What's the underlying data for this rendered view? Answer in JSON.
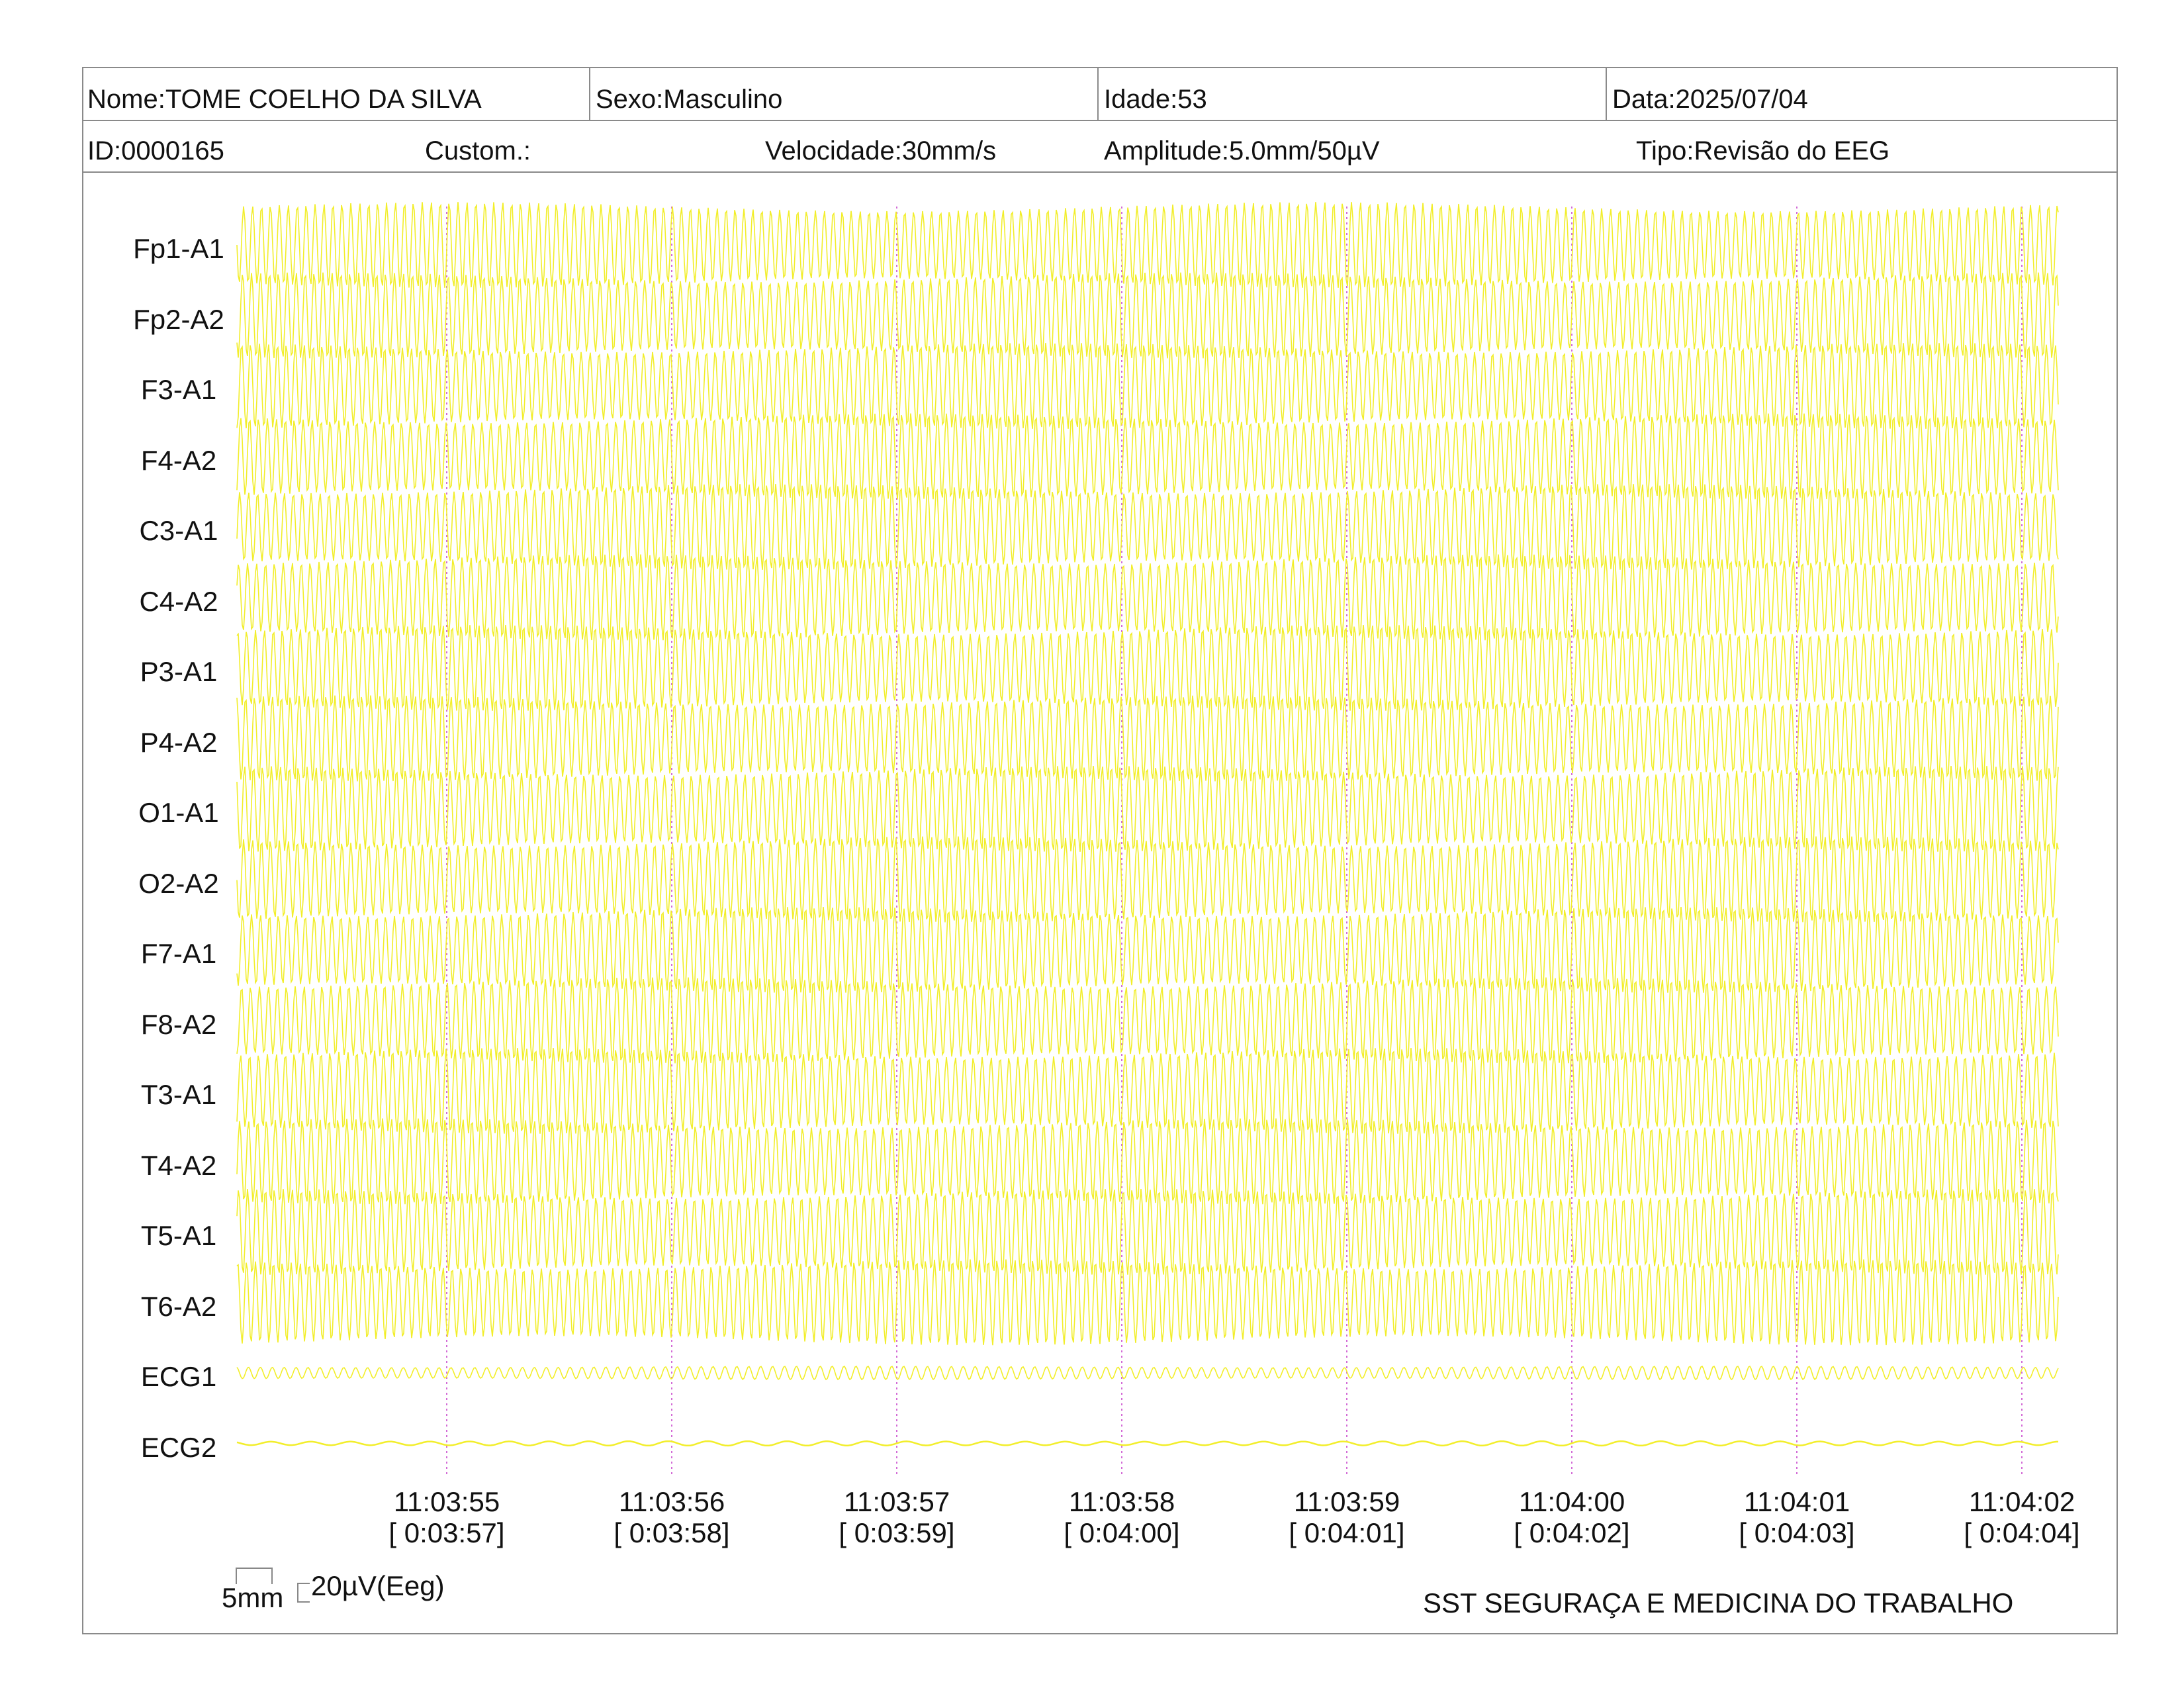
{
  "header": {
    "nome": "Nome:TOME COELHO DA SILVA",
    "sexo": "Sexo:Masculino",
    "idade": "Idade:53",
    "data": "Data:2025/07/04",
    "id": "ID:0000165",
    "custom": "Custom.:",
    "velocidade": "Velocidade:30mm/s",
    "amplitude": "Amplitude:5.0mm/50µV",
    "tipo": "Tipo:Revisão do EEG"
  },
  "channels": [
    "Fp1-A1",
    "Fp2-A2",
    "F3-A1",
    "F4-A2",
    "C3-A1",
    "C4-A2",
    "P3-A1",
    "P4-A2",
    "O1-A1",
    "O2-A2",
    "F7-A1",
    "F8-A2",
    "T3-A1",
    "T4-A2",
    "T5-A1",
    "T6-A2",
    "ECG1",
    "ECG2"
  ],
  "time_marks": [
    {
      "clock": "11:03:55",
      "elapsed": "[ 0:03:57]"
    },
    {
      "clock": "11:03:56",
      "elapsed": "[ 0:03:58]"
    },
    {
      "clock": "11:03:57",
      "elapsed": "[ 0:03:59]"
    },
    {
      "clock": "11:03:58",
      "elapsed": "[ 0:04:00]"
    },
    {
      "clock": "11:03:59",
      "elapsed": "[ 0:04:01]"
    },
    {
      "clock": "11:04:00",
      "elapsed": "[ 0:04:02]"
    },
    {
      "clock": "11:04:01",
      "elapsed": "[ 0:04:03]"
    },
    {
      "clock": "11:04:02",
      "elapsed": "[ 0:04:04]"
    }
  ],
  "scale": {
    "time": "5mm",
    "amplitude": "20µV(Eeg)"
  },
  "footer": {
    "company": "SST SEGURAÇA E MEDICINA DO TRABALHO"
  },
  "colors": {
    "trace": "#f2ee2a",
    "second_marker": "#d36ad6",
    "border": "#8a8a8a"
  }
}
